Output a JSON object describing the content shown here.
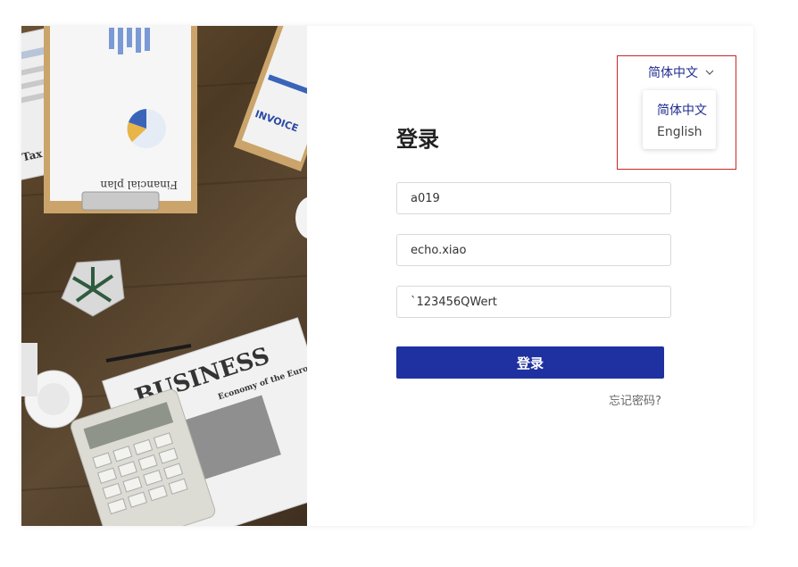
{
  "language": {
    "current": "简体中文",
    "options": [
      "简体中文",
      "English"
    ]
  },
  "login": {
    "title": "登录",
    "company_value": "a019",
    "username_value": "echo.xiao",
    "password_value": "`123456QWert",
    "submit_label": "登录",
    "forgot_label": "忘记密码?"
  },
  "hero_image": {
    "texts": [
      "Financial plan",
      "Tax Refund",
      "INVOICE",
      "BUSINESS",
      "Economy of the European Union"
    ]
  },
  "colors": {
    "accent": "#1f31a0",
    "highlight_border": "#c62828",
    "language_text": "#1f2d8f"
  },
  "icons": {
    "dropdown": "chevron-down-icon"
  }
}
